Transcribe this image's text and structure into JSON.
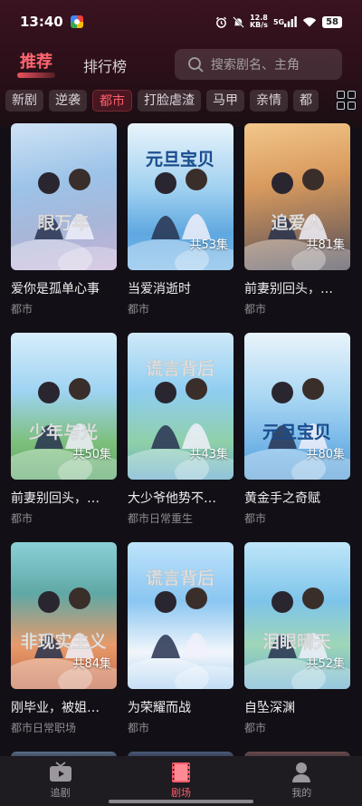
{
  "status_bar": {
    "time": "13:40",
    "speed_value": "12.8",
    "speed_unit": "KB/s",
    "network": "5G",
    "battery": "58"
  },
  "header": {
    "tab_recommend": "推荐",
    "tab_ranking": "排行榜",
    "search_placeholder": "搜索剧名、主角"
  },
  "categories": [
    "新剧",
    "逆袭",
    "都市",
    "打脸虐渣",
    "马甲",
    "亲情",
    "都"
  ],
  "active_category": "都市",
  "cards": [
    {
      "title": "爱你是孤单心事",
      "tags": "都市",
      "count": ""
    },
    {
      "title": "当爱消逝时",
      "tags": "都市",
      "count": "共53集"
    },
    {
      "title": "前妻别回头，…",
      "tags": "都市",
      "count": "共81集"
    },
    {
      "title": "前妻别回头，…",
      "tags": "都市",
      "count": "共50集"
    },
    {
      "title": "大少爷他势不…",
      "tags": "都市日常重生",
      "count": "共43集"
    },
    {
      "title": "黄金手之奇赋",
      "tags": "都市",
      "count": "共80集"
    },
    {
      "title": "刚毕业，被姐…",
      "tags": "都市日常职场",
      "count": "共84集"
    },
    {
      "title": "为荣耀而战",
      "tags": "都市",
      "count": ""
    },
    {
      "title": "自坠深渊",
      "tags": "都市",
      "count": "共52集"
    }
  ],
  "cover_lettering": [
    "眼万年",
    "元旦宝贝",
    "追爱人",
    "少年与光",
    "非现实主义",
    "谎言背后",
    "泪眼晴天"
  ],
  "bottom_nav": {
    "follow": "追剧",
    "theater": "剧场",
    "me": "我的"
  },
  "colors": {
    "accent": "#ff5e6b",
    "background": "#121016",
    "header_bg": "#3a1320"
  }
}
